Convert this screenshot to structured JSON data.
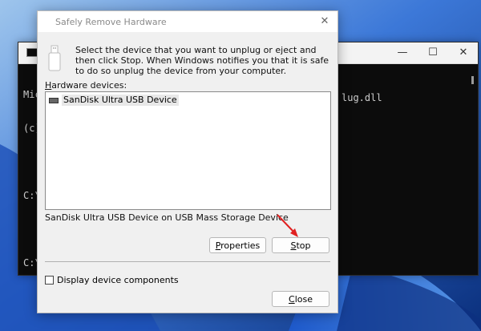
{
  "cmd_window": {
    "lines": [
      "Mic",
      "(c)",
      "",
      "C:\\",
      "",
      "C:\\"
    ],
    "tail_text": "lug.dll",
    "controls": {
      "minimize": "—",
      "maximize": "☐",
      "close": "✕"
    }
  },
  "dialog": {
    "title": "Safely Remove Hardware",
    "close_label": "✕",
    "intro_text": "Select the device that you want to unplug or eject and then click Stop. When Windows notifies you that it is safe to do so unplug the device from your computer.",
    "hardware_label_prefix": "H",
    "hardware_label_rest": "ardware devices:",
    "devices": [
      {
        "name": "SanDisk Ultra USB Device",
        "selected": true
      }
    ],
    "selected_description": "SanDisk Ultra USB Device on USB Mass Storage Device",
    "properties_button": {
      "mnemonic": "P",
      "rest": "roperties"
    },
    "stop_button": {
      "mnemonic": "S",
      "rest": "top"
    },
    "display_components_label": "Display device components",
    "display_components_checked": false,
    "close_button": {
      "mnemonic": "C",
      "rest": "lose"
    }
  },
  "colors": {
    "annotation_arrow": "#e02020",
    "wallpaper": "#0b3f9a"
  }
}
